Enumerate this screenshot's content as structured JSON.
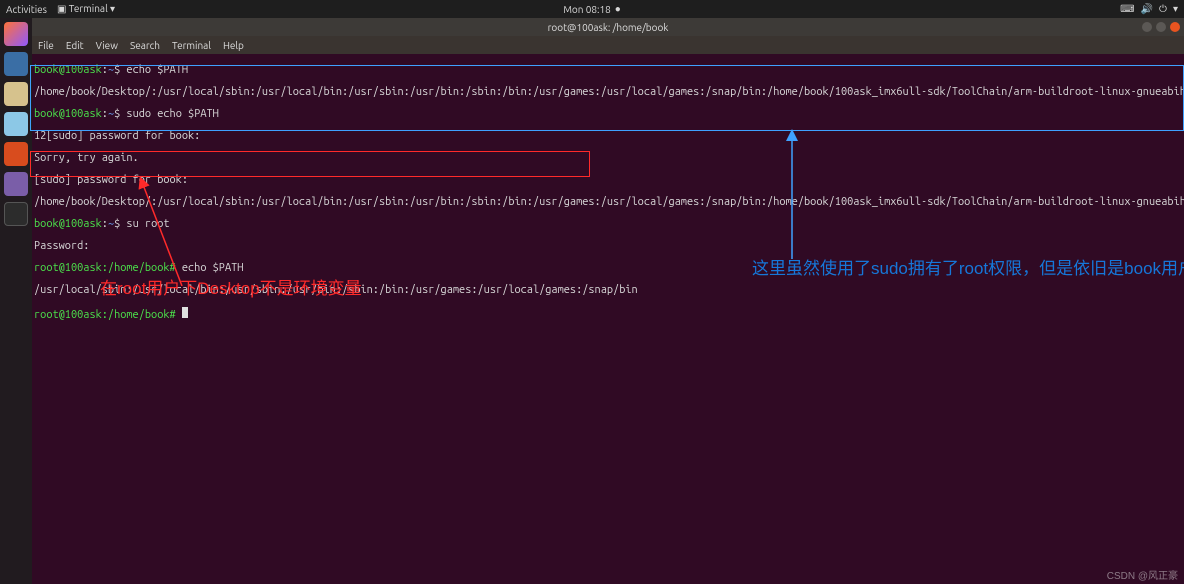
{
  "topbar": {
    "activities": "Activities",
    "appindicator": "Terminal ▾",
    "clock": "Mon 08:18",
    "sound_icon": "sound-icon",
    "power_icon": "power-icon",
    "caret_icon": "caret-down-icon"
  },
  "dock": {
    "items": [
      "firefox",
      "thunderbird",
      "files",
      "rhythmbox",
      "software",
      "help",
      "terminal"
    ]
  },
  "titlebar": {
    "title": "root@100ask: /home/book"
  },
  "menubar": {
    "items": [
      "File",
      "Edit",
      "View",
      "Search",
      "Terminal",
      "Help"
    ]
  },
  "term": {
    "l0_user": "book@100ask",
    "l0_sep": ":",
    "l0_path": "~",
    "l0_cmd": "$ echo $PATH",
    "l1": "/home/book/Desktop/:/usr/local/sbin:/usr/local/bin:/usr/sbin:/usr/bin:/sbin:/bin:/usr/games:/usr/local/games:/snap/bin:/home/book/100ask_imx6ull-sdk/ToolChain/arm-buildroot-linux-gnueabihf_sdk-buildroot/bin",
    "l2_user": "book@100ask",
    "l2_sep": ":",
    "l2_path": "~",
    "l2_cmd": "$ sudo echo $PATH",
    "l3": "12[sudo] password for book: ",
    "l4": "Sorry, try again.",
    "l5": "[sudo] password for book: ",
    "l6": "/home/book/Desktop/:/usr/local/sbin:/usr/local/bin:/usr/sbin:/usr/bin:/sbin:/bin:/usr/games:/usr/local/games:/snap/bin:/home/book/100ask_imx6ull-sdk/ToolChain/arm-buildroot-linux-gnueabihf_sdk-buildroot/bin",
    "l7_user": "book@100ask",
    "l7_sep": ":",
    "l7_path": "~",
    "l7_cmd": "$ su root",
    "l8": "Password: ",
    "l9_root": "root@100ask:/home/book#",
    "l9_cmd": " echo $PATH",
    "l10": "/usr/local/sbin:/usr/local/bin:/usr/sbin:/usr/bin:/sbin:/bin:/usr/games:/usr/local/games:/snap/bin",
    "l11_root": "root@100ask:/home/book#",
    "l11_cmd": " "
  },
  "annot": {
    "red": "在root用户下Desktop不是环境变量",
    "blue": "这里虽然使用了sudo拥有了root权限，但是依旧是book用户，所以环境变量中依旧有Desktop"
  },
  "watermark": "CSDN @风正豪"
}
